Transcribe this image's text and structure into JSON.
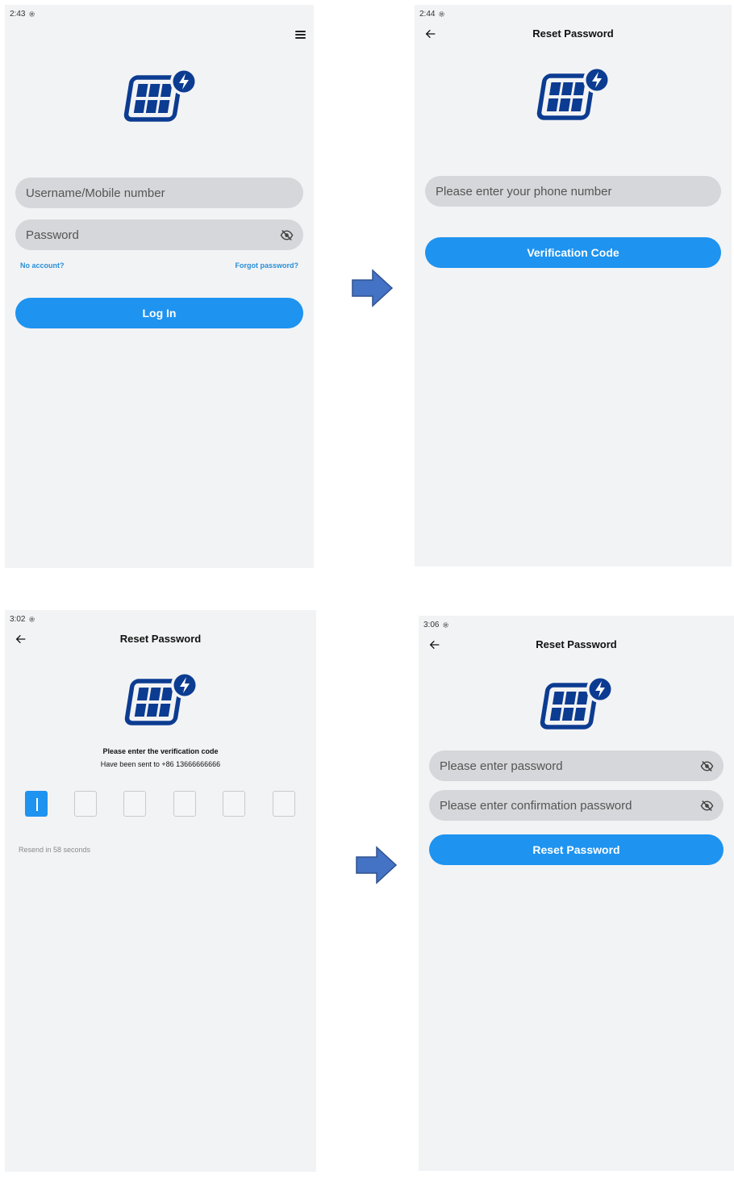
{
  "colors": {
    "primary": "#1e93f0",
    "logo": "#0c3c91",
    "arrow": "#4472c4",
    "field_bg": "#d6d7da",
    "screen_bg": "#f2f3f5"
  },
  "screens": {
    "login": {
      "time": "2:43",
      "username_placeholder": "Username/Mobile number",
      "password_placeholder": "Password",
      "no_account": "No account?",
      "forgot_password": "Forgot password?",
      "login_button": "Log In"
    },
    "reset_phone": {
      "time": "2:44",
      "title": "Reset Password",
      "phone_placeholder": "Please enter your phone number",
      "verification_button": "Verification Code"
    },
    "verify_code": {
      "time": "3:02",
      "title": "Reset Password",
      "prompt": "Please enter the verification code",
      "sent_to": "Have been sent to +86 13666666666",
      "resend": "Resend in 58 seconds"
    },
    "new_password": {
      "time": "3:06",
      "title": "Reset Password",
      "password_placeholder": "Please enter password",
      "confirm_placeholder": "Please enter confirmation password",
      "reset_button": "Reset Password"
    }
  }
}
